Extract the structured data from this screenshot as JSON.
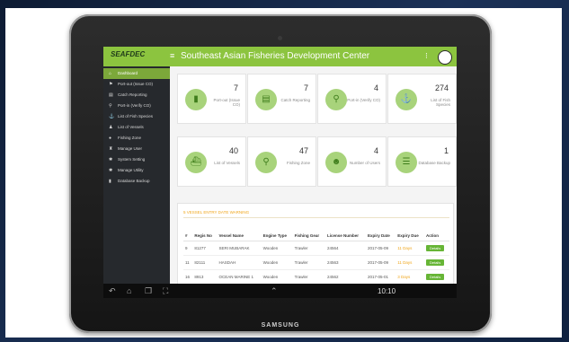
{
  "app": {
    "logo_text": "SEAFDEC",
    "title": "Southeast Asian Fisheries Development Center"
  },
  "sidebar": {
    "items": [
      {
        "label": "Dashboard",
        "icon": "home-icon",
        "active": true
      },
      {
        "label": "Port-out (Issue CO)",
        "icon": "port-icon"
      },
      {
        "label": "Catch Reporting",
        "icon": "report-icon"
      },
      {
        "label": "Port-in (Verify CO)",
        "icon": "verify-icon"
      },
      {
        "label": "List of Fish Species",
        "icon": "fish-icon"
      },
      {
        "label": "List of Vessels",
        "icon": "ship-icon"
      },
      {
        "label": "Fishing Zone",
        "icon": "zone-icon"
      },
      {
        "label": "Manage User",
        "icon": "user-icon"
      },
      {
        "label": "System Setting",
        "icon": "settings-icon"
      },
      {
        "label": "Manage Utility",
        "icon": "utility-icon"
      },
      {
        "label": "Database Backup",
        "icon": "database-icon"
      }
    ]
  },
  "cards": [
    {
      "value": "7",
      "label": "Port-out (Issue CO)",
      "icon": "port-out-icon",
      "glyph": "▮"
    },
    {
      "value": "7",
      "label": "Catch Reporting",
      "icon": "catch-report-icon",
      "glyph": "▤"
    },
    {
      "value": "4",
      "label": "Port-in (Verify CO)",
      "icon": "verify-key-icon",
      "glyph": "⚲"
    },
    {
      "value": "274",
      "label": "List of Fish Species",
      "icon": "anchor-icon",
      "glyph": "⚓"
    },
    {
      "value": "40",
      "label": "List of Vessels",
      "icon": "vessel-icon",
      "glyph": "⛴"
    },
    {
      "value": "47",
      "label": "Fishing Zone",
      "icon": "location-pin-icon",
      "glyph": "⚲"
    },
    {
      "value": "4",
      "label": "Number of Users",
      "icon": "users-icon",
      "glyph": "☻"
    },
    {
      "value": "1",
      "label": "Database Backup",
      "icon": "database-icon",
      "glyph": "☰"
    }
  ],
  "panel": {
    "title": "5 VESSEL ENTRY DATE WARNING"
  },
  "table": {
    "headers": [
      "#",
      "Regis No",
      "Vessel Name",
      "Engine Type",
      "Fishing Gear",
      "License Number",
      "Expiry Date",
      "Expiry Due",
      "Action"
    ],
    "rows": [
      [
        "9",
        "81277",
        "SERI MUBARAK",
        "Wooden",
        "Trawler",
        "24564",
        "2017-05-09",
        "11 Days",
        "Details"
      ],
      [
        "11",
        "82111",
        "HASDAH",
        "Wooden",
        "Trawler",
        "24563",
        "2017-05-09",
        "11 Days",
        "Details"
      ],
      [
        "16",
        "8913",
        "OCEAN MARINE 1",
        "Wooden",
        "Trawler",
        "24562",
        "2017-05-01",
        "3 Days",
        "Details"
      ]
    ]
  },
  "device": {
    "brand": "SAMSUNG",
    "clock": "10:10"
  },
  "colors": {
    "accent": "#8cc43f",
    "sidebar": "#26292d",
    "warning": "#f0a61b"
  }
}
